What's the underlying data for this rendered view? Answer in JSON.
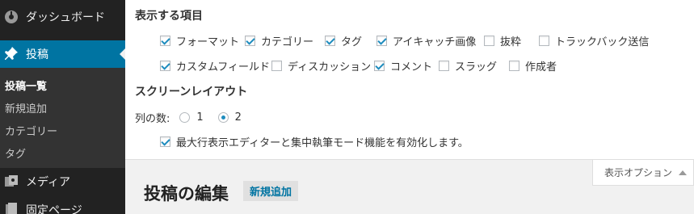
{
  "sidebar": {
    "items": [
      {
        "label": "ダッシュボード",
        "icon": "dashboard-icon"
      },
      {
        "label": "投稿",
        "icon": "pin-icon"
      },
      {
        "label": "メディア",
        "icon": "media-icon"
      },
      {
        "label": "固定ページ",
        "icon": "page-icon"
      }
    ],
    "submenu": [
      "投稿一覧",
      "新規追加",
      "カテゴリー",
      "タグ"
    ]
  },
  "screen_options": {
    "items_heading": "表示する項目",
    "columns": [
      {
        "label": "フォーマット",
        "checked": true
      },
      {
        "label": "カテゴリー",
        "checked": true
      },
      {
        "label": "タグ",
        "checked": true
      },
      {
        "label": "アイキャッチ画像",
        "checked": true
      },
      {
        "label": "抜粋",
        "checked": false
      },
      {
        "label": "トラックバック送信",
        "checked": false
      },
      {
        "label": "カスタムフィールド",
        "checked": true
      },
      {
        "label": "ディスカッション",
        "checked": false
      },
      {
        "label": "コメント",
        "checked": true
      },
      {
        "label": "スラッグ",
        "checked": false
      },
      {
        "label": "作成者",
        "checked": false
      }
    ],
    "layout_heading": "スクリーンレイアウト",
    "columns_label": "列の数:",
    "column_options": [
      "1",
      "2"
    ],
    "selected_columns": "2",
    "editor_option": {
      "label": "最大行表示エディターと集中執筆モード機能を有効化します。",
      "checked": true
    }
  },
  "screen_options_tab": {
    "label": "表示オプション"
  },
  "page": {
    "title": "投稿の編集",
    "add_new": "新規追加"
  },
  "colors": {
    "sidebar": "#222222",
    "submenu": "#333333",
    "accent": "#0074a2",
    "check": "#1e8cbe"
  }
}
